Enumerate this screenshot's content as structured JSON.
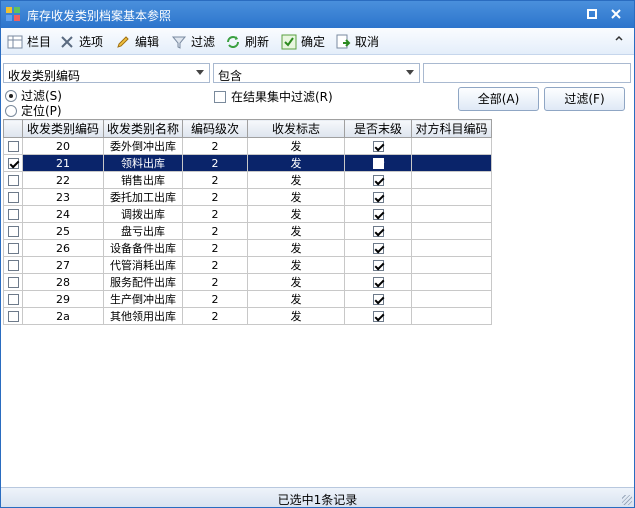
{
  "window": {
    "title": "库存收发类别档案基本参照"
  },
  "toolbar": {
    "items": [
      {
        "label": "栏目",
        "icon": "columns-icon"
      },
      {
        "label": "选项",
        "icon": "options-icon"
      },
      {
        "label": "编辑",
        "icon": "edit-icon"
      },
      {
        "label": "过滤",
        "icon": "filter-icon"
      },
      {
        "label": "刷新",
        "icon": "refresh-icon"
      },
      {
        "label": "确定",
        "icon": "confirm-icon"
      },
      {
        "label": "取消",
        "icon": "cancel-icon"
      }
    ]
  },
  "filter": {
    "field_combo": "收发类别编码",
    "operator_combo": "包含",
    "value_input": "",
    "radio_filter": "过滤(S)",
    "radio_locate": "定位(P)",
    "in_result_label": "在结果集中过滤(R)",
    "all_button": "全部(A)",
    "filter_button": "过滤(F)"
  },
  "grid": {
    "columns": [
      "",
      "收发类别编码",
      "收发类别名称",
      "编码级次",
      "收发标志",
      "是否末级",
      "对方科目编码"
    ],
    "rows": [
      {
        "selected": false,
        "code": "20",
        "name": "委外倒冲出库",
        "level": "2",
        "flag": "发",
        "leaf": true,
        "account": ""
      },
      {
        "selected": true,
        "code": "21",
        "name": "领料出库",
        "level": "2",
        "flag": "发",
        "leaf": true,
        "account": ""
      },
      {
        "selected": false,
        "code": "22",
        "name": "销售出库",
        "level": "2",
        "flag": "发",
        "leaf": true,
        "account": ""
      },
      {
        "selected": false,
        "code": "23",
        "name": "委托加工出库",
        "level": "2",
        "flag": "发",
        "leaf": true,
        "account": ""
      },
      {
        "selected": false,
        "code": "24",
        "name": "调拨出库",
        "level": "2",
        "flag": "发",
        "leaf": true,
        "account": ""
      },
      {
        "selected": false,
        "code": "25",
        "name": "盘亏出库",
        "level": "2",
        "flag": "发",
        "leaf": true,
        "account": ""
      },
      {
        "selected": false,
        "code": "26",
        "name": "设备备件出库",
        "level": "2",
        "flag": "发",
        "leaf": true,
        "account": ""
      },
      {
        "selected": false,
        "code": "27",
        "name": "代管消耗出库",
        "level": "2",
        "flag": "发",
        "leaf": true,
        "account": ""
      },
      {
        "selected": false,
        "code": "28",
        "name": "服务配件出库",
        "level": "2",
        "flag": "发",
        "leaf": true,
        "account": ""
      },
      {
        "selected": false,
        "code": "29",
        "name": "生产倒冲出库",
        "level": "2",
        "flag": "发",
        "leaf": true,
        "account": ""
      },
      {
        "selected": false,
        "code": "2a",
        "name": "其他领用出库",
        "level": "2",
        "flag": "发",
        "leaf": true,
        "account": ""
      }
    ]
  },
  "status": {
    "text": "已选中1条记录"
  },
  "colors": {
    "title_bar": "#2c74cc",
    "selection": "#0a246a"
  }
}
